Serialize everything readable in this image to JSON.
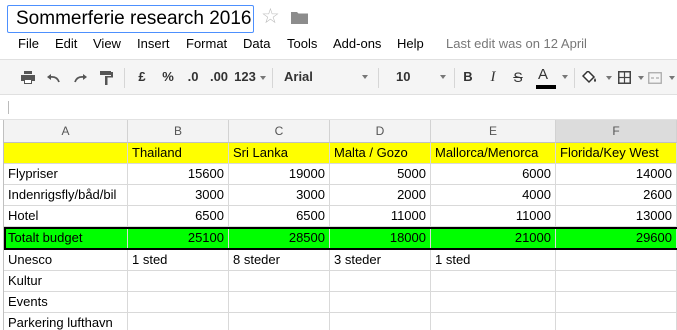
{
  "doc": {
    "title": "Sommerferie research 2016",
    "star_glyph": "☆",
    "last_edit": "Last edit was on 12 April"
  },
  "menu": [
    "File",
    "Edit",
    "View",
    "Insert",
    "Format",
    "Data",
    "Tools",
    "Add-ons",
    "Help"
  ],
  "toolbar": {
    "currency": "£",
    "percent": "%",
    "dec_decrease": ".0",
    "dec_increase": ".00",
    "more_formats": "123",
    "font": "Arial",
    "font_size": "10",
    "bold": "B",
    "italic": "I",
    "strike": "S",
    "text_color": "A",
    "text_color_hex": "#000000"
  },
  "sheet": {
    "columns": [
      "A",
      "B",
      "C",
      "D",
      "E",
      "F"
    ],
    "selected_column": "F",
    "header_row": [
      "",
      "Thailand",
      "Sri Lanka",
      "Malta / Gozo",
      "Mallorca/Menorca",
      "Florida/Key West"
    ],
    "rows": [
      [
        "Flypriser",
        "15600",
        "19000",
        "5000",
        "6000",
        "14000"
      ],
      [
        "Indenrigsfly/båd/bil",
        "3000",
        "3000",
        "2000",
        "4000",
        "2600"
      ],
      [
        "Hotel",
        "6500",
        "6500",
        "11000",
        "11000",
        "13000"
      ]
    ],
    "total_row": [
      "Totalt budget",
      "25100",
      "28500",
      "18000",
      "21000",
      "29600"
    ],
    "extra_rows": [
      [
        "Unesco",
        "1 sted",
        "8 steder",
        "3 steder",
        "1 sted",
        ""
      ],
      [
        "Kultur",
        "",
        "",
        "",
        "",
        ""
      ],
      [
        "Events",
        "",
        "",
        "",
        "",
        ""
      ],
      [
        "Parkering lufthavn",
        "",
        "",
        "",
        "",
        ""
      ]
    ],
    "colors": {
      "header_fill": "#ffff00",
      "total_fill": "#00ff00"
    }
  }
}
